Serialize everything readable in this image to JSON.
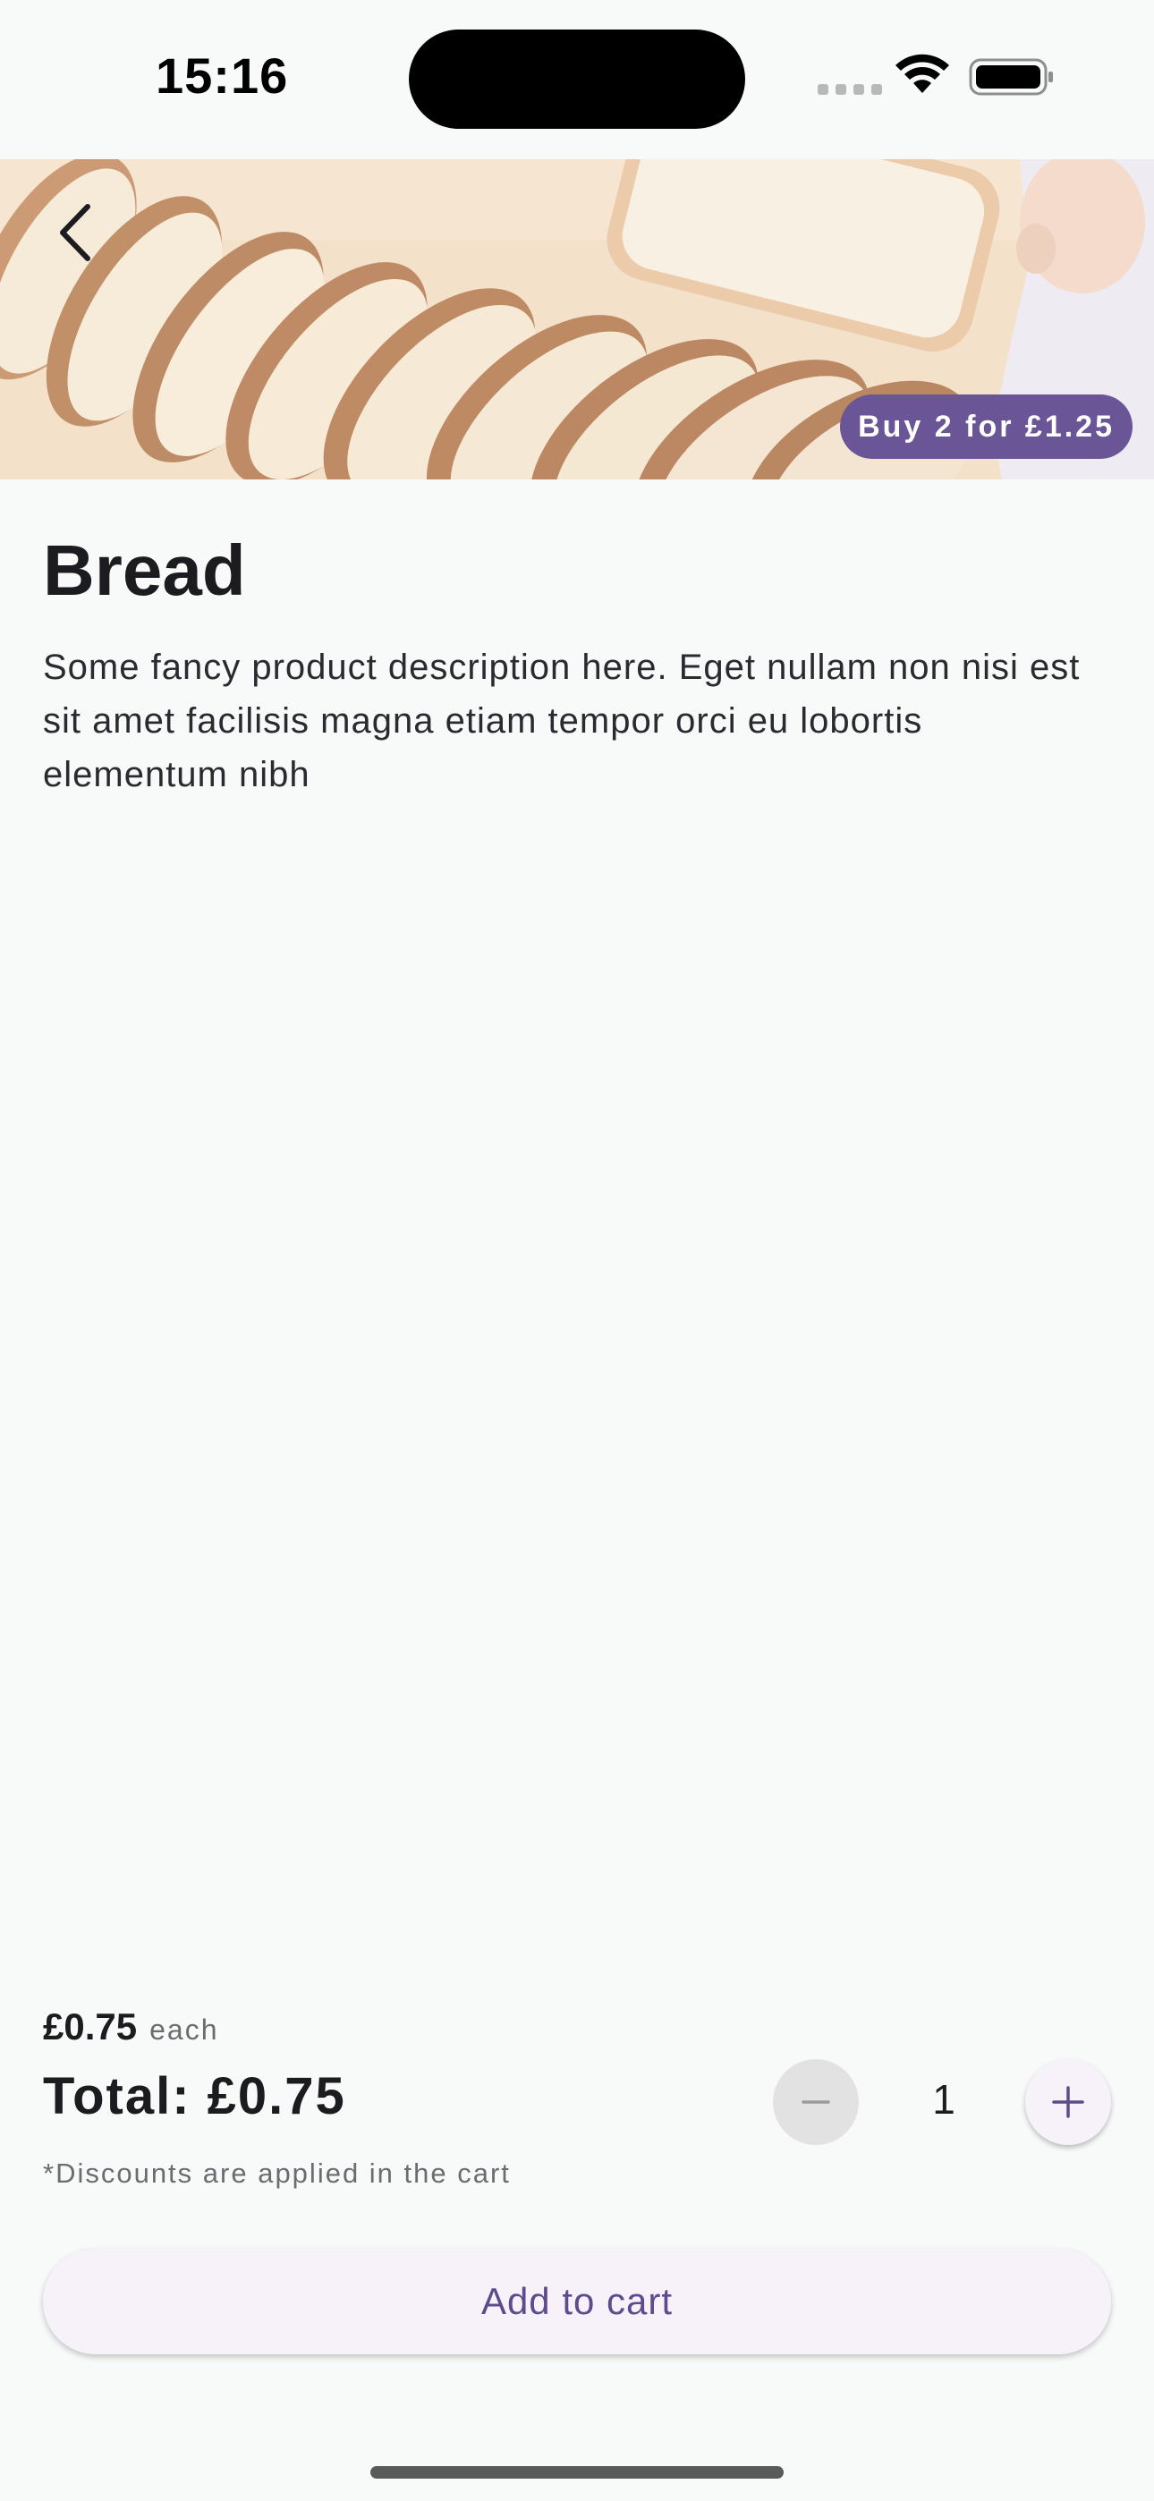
{
  "status_bar": {
    "time": "15:16"
  },
  "product": {
    "deal_badge": "Buy 2 for £1.25",
    "title": "Bread",
    "description": "Some fancy product description here. Eget nullam non nisi est sit amet facilisis magna etiam tempor orci eu lobortis elementum nibh"
  },
  "pricing": {
    "unit_price": "£0.75",
    "unit_label": "each",
    "total": "Total: £0.75",
    "discount_note": "*Discounts are applied in the cart"
  },
  "quantity": {
    "value": "1",
    "decrement_icon": "minus-icon",
    "increment_icon": "plus-icon"
  },
  "actions": {
    "add_to_cart": "Add to cart",
    "back_icon": "chevron-left-icon"
  },
  "colors": {
    "accent": "#6a5596",
    "button_bg": "#f7f2fa",
    "button_text": "#5e4b8b",
    "background": "#f8faf9"
  }
}
